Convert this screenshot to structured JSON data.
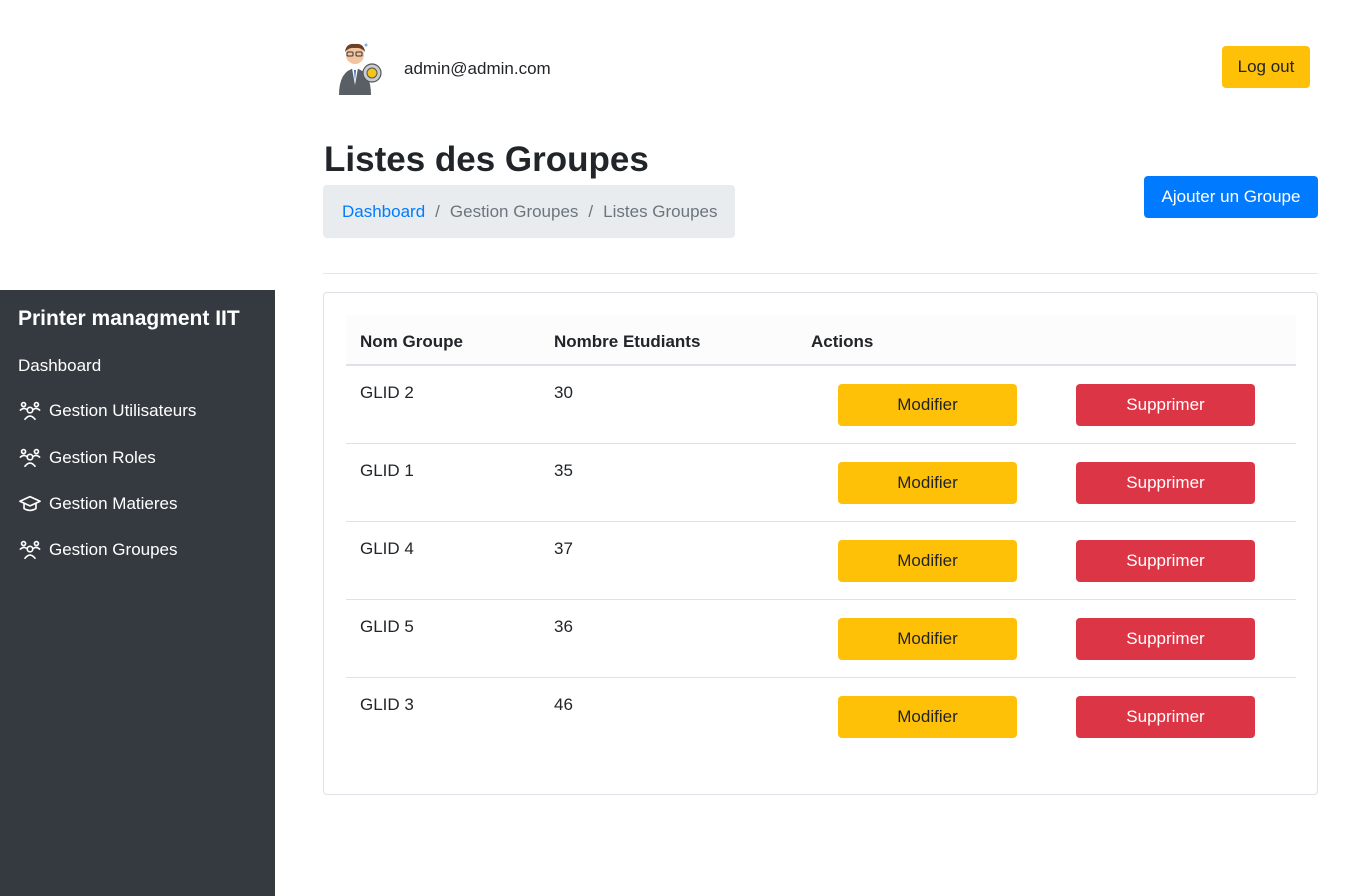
{
  "sidebar": {
    "brand": "Printer managment IIT",
    "items": [
      {
        "label": "Dashboard",
        "icon": ""
      },
      {
        "label": "Gestion Utilisateurs",
        "icon": "users-icon"
      },
      {
        "label": "Gestion Roles",
        "icon": "users-icon"
      },
      {
        "label": "Gestion Matieres",
        "icon": "graduation-cap-icon"
      },
      {
        "label": "Gestion Groupes",
        "icon": "users-icon"
      }
    ]
  },
  "header": {
    "user_email": "admin@admin.com",
    "logout_label": "Log out"
  },
  "page": {
    "title": "Listes des Groupes",
    "add_button_label": "Ajouter un Groupe",
    "breadcrumb": [
      "Dashboard",
      "Gestion Groupes",
      "Listes Groupes"
    ],
    "breadcrumb_separator": "/"
  },
  "table": {
    "columns": [
      "Nom Groupe",
      "Nombre Etudiants",
      "Actions"
    ],
    "rows": [
      {
        "name": "GLID 2",
        "count": "30",
        "edit": "Modifier",
        "delete": "Supprimer"
      },
      {
        "name": "GLID 1",
        "count": "35",
        "edit": "Modifier",
        "delete": "Supprimer"
      },
      {
        "name": "GLID 4",
        "count": "37",
        "edit": "Modifier",
        "delete": "Supprimer"
      },
      {
        "name": "GLID 5",
        "count": "36",
        "edit": "Modifier",
        "delete": "Supprimer"
      },
      {
        "name": "GLID 3",
        "count": "46",
        "edit": "Modifier",
        "delete": "Supprimer"
      }
    ]
  },
  "colors": {
    "sidebar_bg": "#343a40",
    "primary": "#007bff",
    "warning": "#ffc107",
    "danger": "#dc3545",
    "breadcrumb_bg": "#e9ecef"
  }
}
